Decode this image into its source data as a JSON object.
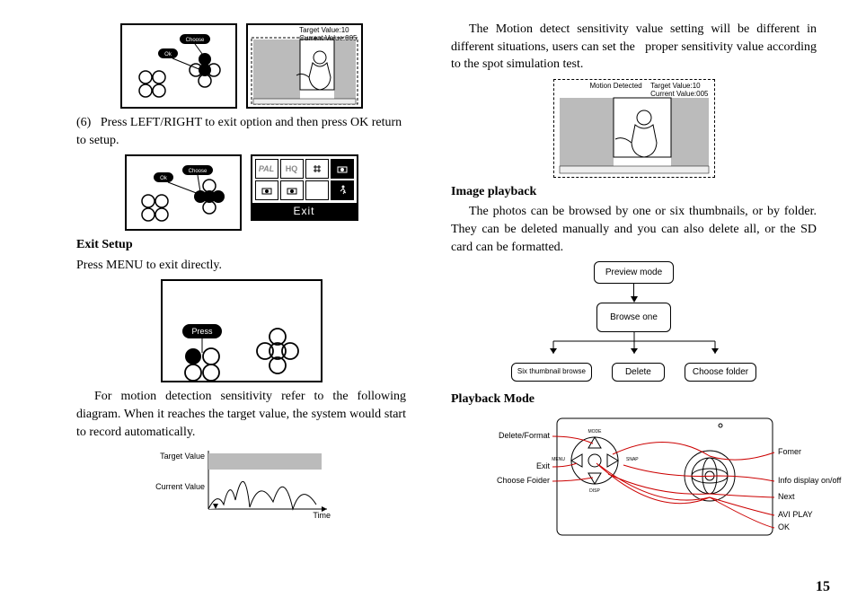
{
  "left": {
    "step6_label": "(6)",
    "step6_text": "Press LEFT/RIGHT to exit option and then press OK return to setup.",
    "exit_setup_heading": "Exit Setup",
    "exit_setup_text": "Press MENU to exit directly.",
    "motion_intro": "For motion detection sensitivity refer to the following diagram. When it reaches the target value, the system would start to record automatically.",
    "graph": {
      "target_label": "Target Value",
      "current_label": "Current Value",
      "time_label": "Time"
    },
    "camera_overlay": {
      "line1": "Target Value:10",
      "line2": "Current Value:005"
    },
    "buttons": {
      "choose": "Choose",
      "ok": "Ok",
      "press": "Press"
    },
    "icon_grid": {
      "pal": "PAL",
      "hq": "HQ",
      "exit": "Exit"
    }
  },
  "right": {
    "motion_para": "The Motion detect sensitivity value setting will be different in different situations, users can set the   proper sensitivity value according to the spot simulation test.",
    "motion_detected_caption": "Motion Detected",
    "camera_overlay": {
      "line1": "Target Value:10",
      "line2": "Current Value:005"
    },
    "image_playback_heading": "Image playback",
    "image_playback_text": "The photos can be browsed by one or six thumbnails, or by folder. They can be deleted manually and you can also delete all, or the SD card can be formatted.",
    "flow": {
      "preview": "Preview mode",
      "browse_one": "Browse one",
      "six_thumb": "Six thumbnail browse",
      "delete": "Delete",
      "choose_folder": "Choose folder"
    },
    "playback_mode_heading": "Playback Mode",
    "device": {
      "delete_format": "Delete/Format",
      "exit": "Exit",
      "choose_folder": "Choose Foider",
      "fomer": "Fomer",
      "info": "Info display on/off",
      "next": "Next",
      "avi": "AVI PLAY",
      "ok": "OK",
      "mode": "MODE",
      "snap": "SNAP",
      "menu": "MENU",
      "disp": "DISP"
    }
  },
  "page_number": "15"
}
